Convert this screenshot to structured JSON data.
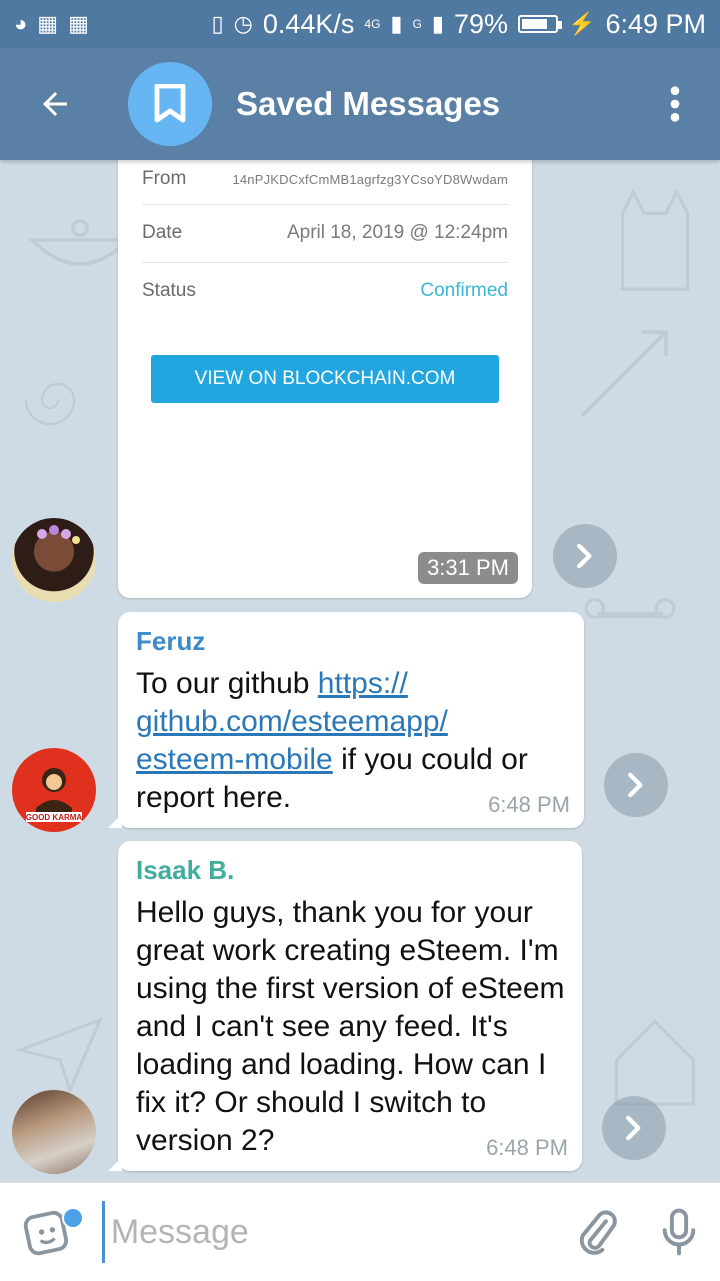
{
  "status_bar": {
    "network_speed": "0.44K/s",
    "network_type": "4G",
    "sim2_type": "G",
    "battery_percent": "79%",
    "battery_level": 0.79,
    "time": "6:49 PM"
  },
  "header": {
    "title": "Saved Messages",
    "back_icon": "arrow-left-icon",
    "chat_icon": "bookmark-icon",
    "menu_icon": "more-vertical-icon"
  },
  "transaction": {
    "from_label": "From",
    "from_value": "14nPJKDCxfCmMB1agrfzg3YCsoYD8Wwdam",
    "date_label": "Date",
    "date_value": "April 18, 2019 @ 12:24pm",
    "status_label": "Status",
    "status_value": "Confirmed",
    "button_label": "VIEW ON BLOCKCHAIN.COM",
    "time": "3:31 PM"
  },
  "messages": [
    {
      "sender": "Feruz",
      "sender_color": "#3d8bc7",
      "text_before": "To our github ",
      "link": "https://github.com/esteemapp/esteem-mobile",
      "link_lines": [
        "https://",
        "github.com/esteemapp/",
        "esteem-mobile"
      ],
      "text_after": " if you could or report here.",
      "time": "6:48 PM",
      "avatar_label": "GOOD KARMA"
    },
    {
      "sender": "Isaak B.",
      "sender_color": "#41ad9f",
      "text": "Hello guys, thank you for your great work creating eSteem. I'm using the first version of eSteem and I can't see any feed. It's loading and loading. How can I fix it? Or should I switch to version 2?",
      "time": "6:48 PM"
    }
  ],
  "input": {
    "placeholder": "Message"
  }
}
